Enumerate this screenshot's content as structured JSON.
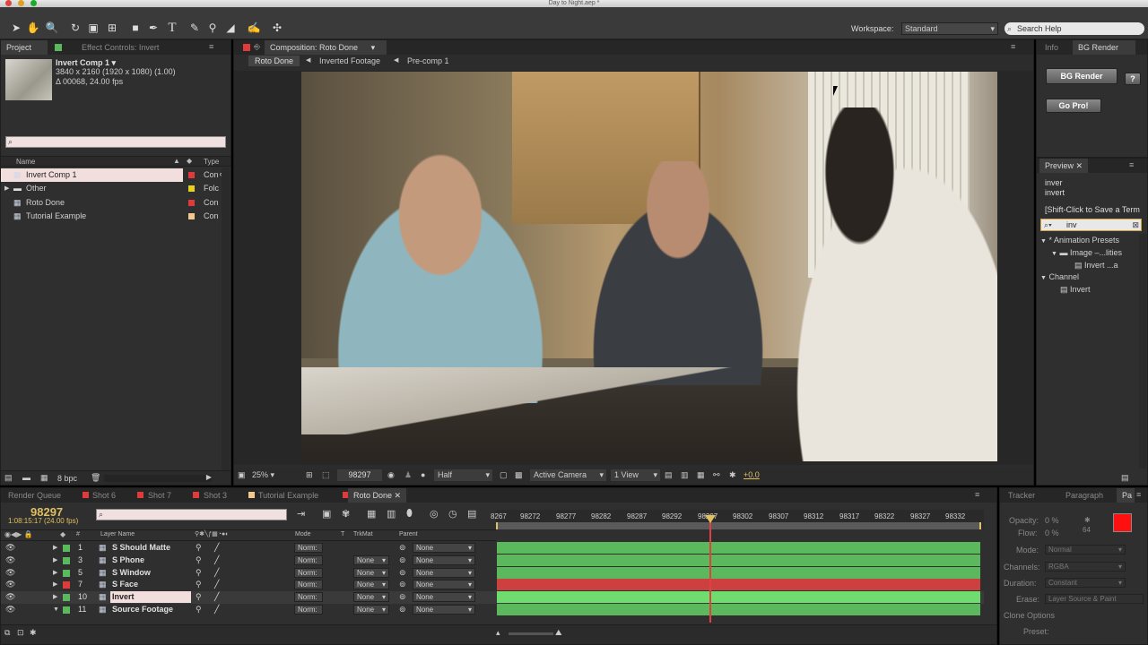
{
  "window": {
    "title": "Day to Night.aep *"
  },
  "toolbar": {
    "workspace_label": "Workspace:",
    "workspace_value": "Standard",
    "search_placeholder": "Search Help"
  },
  "project_panel": {
    "tab_project": "Project",
    "tab_effect_controls": "Effect Controls: Invert",
    "item_name": "Invert Comp 1 ▾",
    "item_dims": "3840 x 2160  (1920 x 1080) (1.00)",
    "item_duration": "Δ 00068, 24.00 fps",
    "search_value": "",
    "col_name": "Name",
    "col_type": "Type",
    "items": [
      {
        "name": "Invert Comp 1",
        "type": "Con",
        "color": "#e03a3a"
      },
      {
        "name": "Other",
        "type": "Folc",
        "color": "#e6d21e"
      },
      {
        "name": "Roto Done",
        "type": "Con",
        "color": "#e03a3a"
      },
      {
        "name": "Tutorial Example",
        "type": "Con",
        "color": "#f0c890"
      }
    ],
    "bpc": "8 bpc"
  },
  "composition": {
    "tab_label": "Composition: Roto Done",
    "crumbs": [
      "Roto Done",
      "Inverted Footage",
      "Pre-comp 1"
    ],
    "zoom": "25%",
    "frame": "98297",
    "resolution": "Half",
    "camera": "Active Camera",
    "views": "1 View",
    "exposure": "+0.0"
  },
  "right_panel": {
    "tab_info": "Info",
    "tab_bg_render": "BG Render",
    "bg_render_button": "BG Render",
    "help_button": "?",
    "go_pro_button": "Go Pro!",
    "preview_tab": "Preview",
    "preview_lines": [
      "inver",
      "invert"
    ],
    "save_hint": "[Shift-Click to Save a Term",
    "effects_search": "inv",
    "tree": [
      {
        "label": "* Animation Presets",
        "indent": 0
      },
      {
        "label": "Image –...lities",
        "indent": 1
      },
      {
        "label": "Invert ...a",
        "indent": 2
      },
      {
        "label": "Channel",
        "indent": 0
      },
      {
        "label": "Invert",
        "indent": 1
      }
    ]
  },
  "timeline": {
    "tabs": [
      "Render Queue",
      "Shot 6",
      "Shot 7",
      "Shot 3",
      "Tutorial Example",
      "Roto Done"
    ],
    "tab_colors": [
      "",
      "#e03a3a",
      "#e03a3a",
      "#e03a3a",
      "#f0c890",
      "#e03a3a"
    ],
    "current_frame": "98297",
    "timecode": "1:08:15:17 (24.00 fps)",
    "col_layer_name": "Layer Name",
    "col_mode": "Mode",
    "col_t": "T",
    "col_trkmat": "TrkMat",
    "col_parent": "Parent",
    "ruler": [
      "8267",
      "98272",
      "98277",
      "98282",
      "98287",
      "98292",
      "98297",
      "98302",
      "98307",
      "98312",
      "98317",
      "98322",
      "98327",
      "98332"
    ],
    "layers": [
      {
        "num": "1",
        "name": "S Should Matte",
        "mode": "Norm:",
        "trkmat": "",
        "parent": "None",
        "color": "#5cb85c"
      },
      {
        "num": "3",
        "name": "S Phone",
        "mode": "Norm:",
        "trkmat": "None",
        "parent": "None",
        "color": "#5cb85c"
      },
      {
        "num": "5",
        "name": "S Window",
        "mode": "Norm:",
        "trkmat": "None",
        "parent": "None",
        "color": "#5cb85c"
      },
      {
        "num": "7",
        "name": "S Face",
        "mode": "Norm:",
        "trkmat": "None",
        "parent": "None",
        "color": "#e03a3a"
      },
      {
        "num": "10",
        "name": "Invert",
        "mode": "Norm:",
        "trkmat": "None",
        "parent": "None",
        "color": "#5cb85c"
      },
      {
        "num": "11",
        "name": "Source Footage",
        "mode": "Norm:",
        "trkmat": "None",
        "parent": "None",
        "color": "#5cb85c"
      }
    ]
  },
  "paint_panel": {
    "tab_tracker": "Tracker",
    "tab_paragraph": "Paragraph",
    "tab_p": "Pa",
    "opacity_label": "Opacity:",
    "opacity_value": "0 %",
    "flow_label": "Flow:",
    "flow_value": "0 %",
    "brush_size": "64",
    "mode_label": "Mode:",
    "mode_value": "Normal",
    "channels_label": "Channels:",
    "channels_value": "RGBA",
    "duration_label": "Duration:",
    "duration_value": "Constant",
    "erase_label": "Erase:",
    "erase_value": "Layer Source & Paint",
    "clone_options": "Clone Options",
    "preset_label": "Preset:"
  }
}
